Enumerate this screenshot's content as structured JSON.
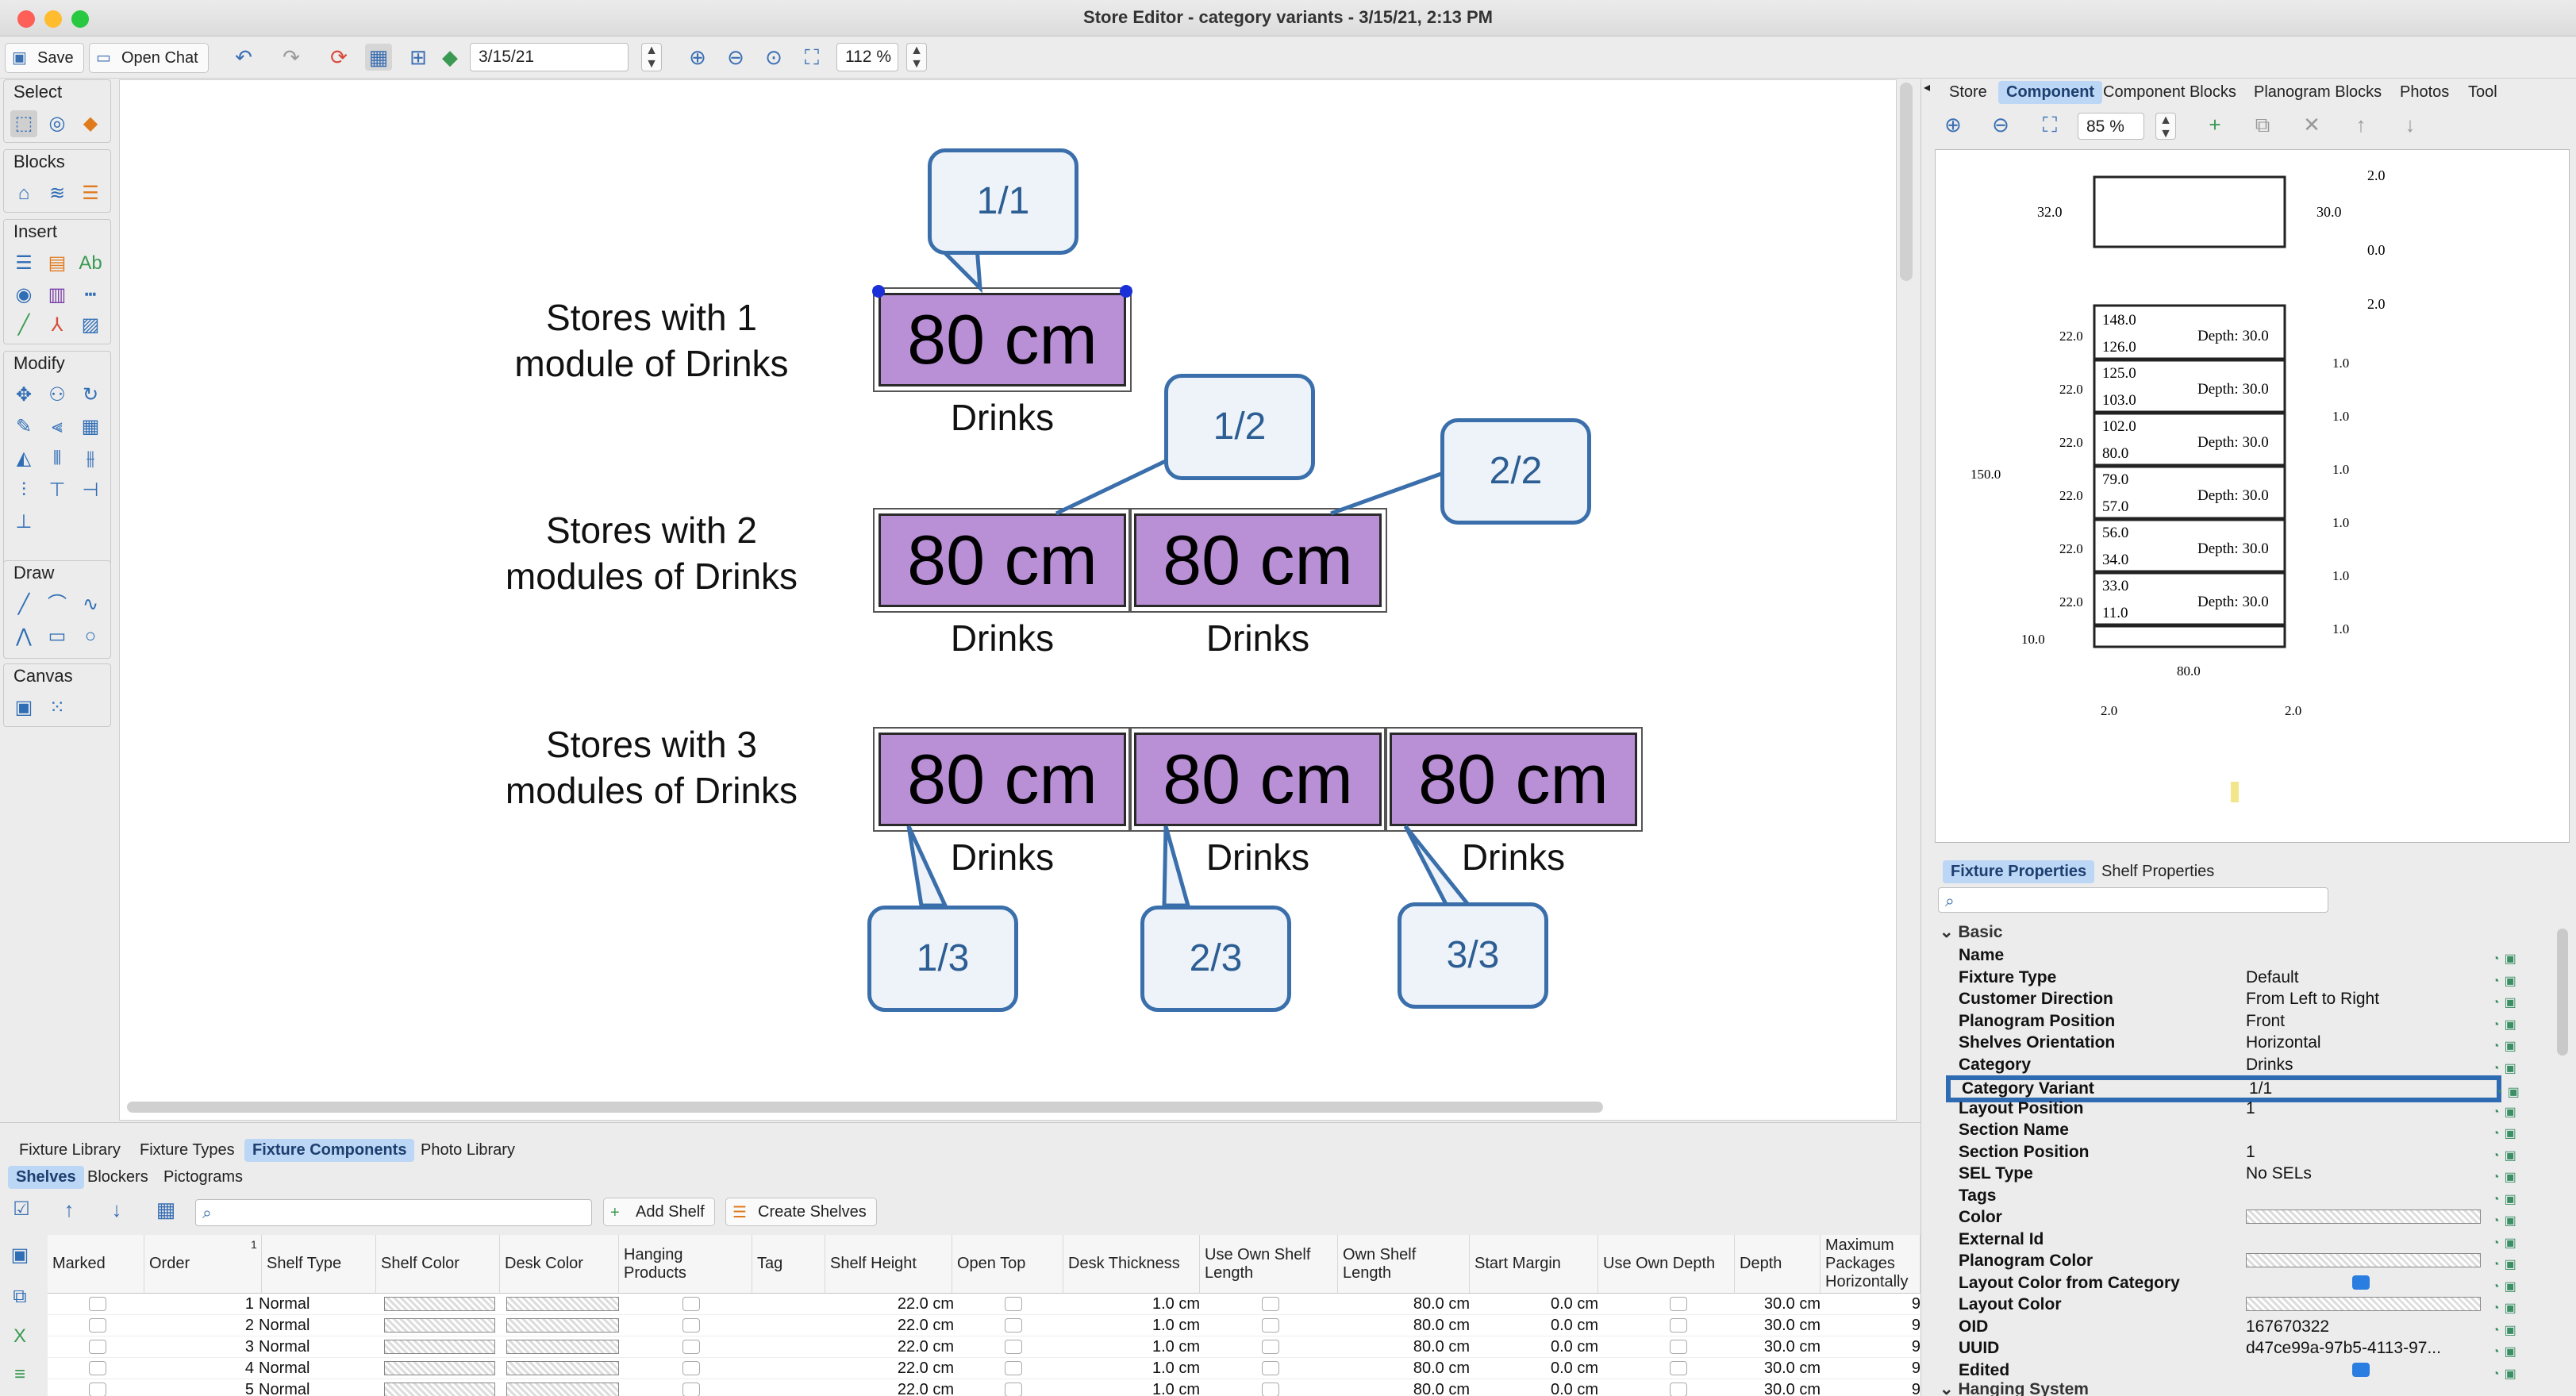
{
  "window": {
    "title": "Store Editor - category variants - 3/15/21, 2:13 PM"
  },
  "toolbar": {
    "save_label": "Save",
    "open_chat_label": "Open Chat",
    "date_value": "3/15/21",
    "zoom_value": "112 %"
  },
  "left_panel": {
    "select": "Select",
    "blocks": "Blocks",
    "insert": "Insert",
    "modify": "Modify",
    "draw": "Draw",
    "canvas": "Canvas"
  },
  "canvas": {
    "store1": "Stores with 1\nmodule of Drinks",
    "store2": "Stores with 2\nmodules of Drinks",
    "store3": "Stores with 3\nmodules of Drinks",
    "module_label": "80 cm",
    "category_label": "Drinks",
    "callouts": [
      "1/1",
      "1/2",
      "2/2",
      "1/3",
      "2/3",
      "3/3"
    ]
  },
  "bottom": {
    "tabs": [
      "Fixture Library",
      "Fixture Types",
      "Fixture Components",
      "Photo Library"
    ],
    "subtabs": [
      "Shelves",
      "Blockers",
      "Pictograms"
    ],
    "add_shelf": "Add Shelf",
    "create_shelves": "Create Shelves",
    "columns": [
      "Marked",
      "Order",
      "Shelf Type",
      "Shelf Color",
      "Desk Color",
      "Hanging Products",
      "Tag",
      "Shelf Height",
      "Open Top",
      "Desk Thickness",
      "Use Own Shelf Length",
      "Own Shelf Length",
      "Start Margin",
      "Use Own Depth",
      "Depth",
      "Maximum Packages Horizontally"
    ],
    "sort_indicator": "1",
    "rows": [
      {
        "order": "1",
        "type": "Normal",
        "height": "22.0 cm",
        "thick": "1.0 cm",
        "len": "80.0 cm",
        "margin": "0.0 cm",
        "depth": "30.0 cm",
        "max": "9"
      },
      {
        "order": "2",
        "type": "Normal",
        "height": "22.0 cm",
        "thick": "1.0 cm",
        "len": "80.0 cm",
        "margin": "0.0 cm",
        "depth": "30.0 cm",
        "max": "9"
      },
      {
        "order": "3",
        "type": "Normal",
        "height": "22.0 cm",
        "thick": "1.0 cm",
        "len": "80.0 cm",
        "margin": "0.0 cm",
        "depth": "30.0 cm",
        "max": "9"
      },
      {
        "order": "4",
        "type": "Normal",
        "height": "22.0 cm",
        "thick": "1.0 cm",
        "len": "80.0 cm",
        "margin": "0.0 cm",
        "depth": "30.0 cm",
        "max": "9"
      },
      {
        "order": "5",
        "type": "Normal",
        "height": "22.0 cm",
        "thick": "1.0 cm",
        "len": "80.0 cm",
        "margin": "0.0 cm",
        "depth": "30.0 cm",
        "max": "9"
      }
    ]
  },
  "right": {
    "tabs": [
      "Store",
      "Component",
      "Component Blocks",
      "Planogram Blocks",
      "Photos",
      "Tool"
    ],
    "zoom_value": "85 %",
    "prop_tabs": [
      "Fixture Properties",
      "Shelf Properties"
    ],
    "section_basic": "Basic",
    "section_hanging": "Hanging System",
    "properties": [
      {
        "k": "Name",
        "v": ""
      },
      {
        "k": "Fixture Type",
        "v": "Default"
      },
      {
        "k": "Customer Direction",
        "v": "From Left to Right"
      },
      {
        "k": "Planogram Position",
        "v": "Front"
      },
      {
        "k": "Shelves Orientation",
        "v": "Horizontal"
      },
      {
        "k": "Category",
        "v": "Drinks"
      },
      {
        "k": "Category Variant",
        "v": "1/1"
      },
      {
        "k": "Layout Position",
        "v": "1"
      },
      {
        "k": "Section Name",
        "v": ""
      },
      {
        "k": "Section Position",
        "v": "1"
      },
      {
        "k": "SEL Type",
        "v": "No SELs"
      },
      {
        "k": "Tags",
        "v": ""
      },
      {
        "k": "Color",
        "v": ""
      },
      {
        "k": "External Id",
        "v": ""
      },
      {
        "k": "Planogram Color",
        "v": ""
      },
      {
        "k": "Layout Color from Category",
        "v": ""
      },
      {
        "k": "Layout Color",
        "v": ""
      },
      {
        "k": "OID",
        "v": "167670322"
      },
      {
        "k": "UUID",
        "v": "d47ce99a-97b5-4113-97..."
      },
      {
        "k": "Edited",
        "v": ""
      }
    ],
    "preview": {
      "shelves": [
        [
          "148.0",
          "126.0"
        ],
        [
          "125.0",
          "103.0"
        ],
        [
          "102.0",
          "80.0"
        ],
        [
          "79.0",
          "57.0"
        ],
        [
          "56.0",
          "34.0"
        ],
        [
          "33.0",
          "11.0"
        ]
      ],
      "depth_label": "Depth: 30.0",
      "gap": "22.0",
      "thick": "1.0",
      "total": "150.0",
      "base": "10.0",
      "width": "80.0",
      "side": "2.0",
      "top_left": "32.0",
      "top_right": "30.0",
      "top_zero": "0.0",
      "top_two": "2.0"
    }
  },
  "colors": {
    "accent": "#3a6fab",
    "module": "#b98fd6",
    "highlight": "#2f6bb3",
    "tab_active": "#bcd7f5"
  }
}
